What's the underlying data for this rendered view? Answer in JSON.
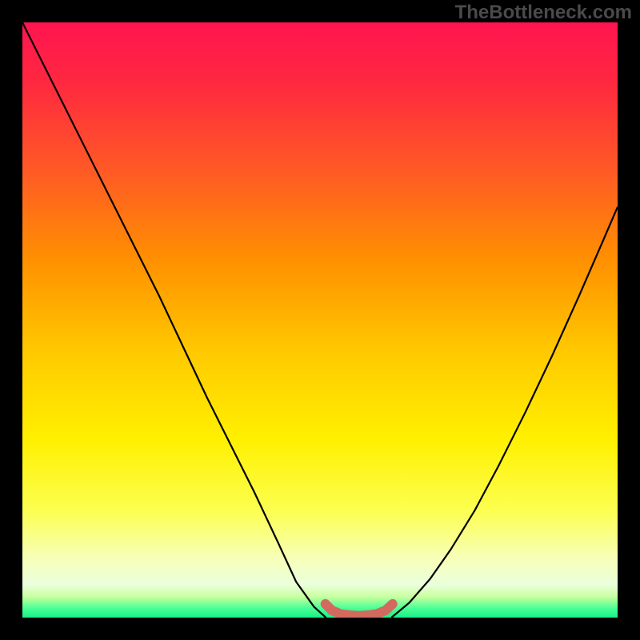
{
  "watermark": "TheBottleneck.com",
  "frame": {
    "outer_width": 800,
    "outer_height": 800,
    "border_px": 28,
    "border_color": "#000000"
  },
  "gradient": {
    "stops": [
      {
        "offset": 0.0,
        "color": "#ff1450"
      },
      {
        "offset": 0.1,
        "color": "#ff2840"
      },
      {
        "offset": 0.25,
        "color": "#ff5a25"
      },
      {
        "offset": 0.4,
        "color": "#ff9000"
      },
      {
        "offset": 0.55,
        "color": "#ffc800"
      },
      {
        "offset": 0.7,
        "color": "#fff000"
      },
      {
        "offset": 0.82,
        "color": "#fcff50"
      },
      {
        "offset": 0.9,
        "color": "#f7ffb8"
      },
      {
        "offset": 0.945,
        "color": "#eaffdc"
      },
      {
        "offset": 0.965,
        "color": "#c8ff9e"
      },
      {
        "offset": 0.985,
        "color": "#46ff96"
      },
      {
        "offset": 1.0,
        "color": "#18f086"
      }
    ]
  },
  "chart_data": {
    "type": "line",
    "title": "",
    "xlabel": "",
    "ylabel": "",
    "xlim": [
      0,
      1
    ],
    "ylim": [
      0,
      1
    ],
    "series": [
      {
        "name": "curve-left",
        "stroke": "#000000",
        "width": 2.2,
        "x": [
          0.0,
          0.03,
          0.07,
          0.11,
          0.15,
          0.19,
          0.23,
          0.27,
          0.31,
          0.35,
          0.39,
          0.43,
          0.46,
          0.49,
          0.51
        ],
        "y": [
          1.0,
          0.94,
          0.86,
          0.78,
          0.7,
          0.62,
          0.54,
          0.455,
          0.37,
          0.29,
          0.21,
          0.125,
          0.06,
          0.018,
          0.0
        ]
      },
      {
        "name": "curve-right",
        "stroke": "#000000",
        "width": 2.2,
        "x": [
          0.62,
          0.65,
          0.685,
          0.72,
          0.76,
          0.8,
          0.845,
          0.89,
          0.935,
          0.975,
          1.0
        ],
        "y": [
          0.0,
          0.025,
          0.065,
          0.115,
          0.18,
          0.255,
          0.345,
          0.44,
          0.54,
          0.632,
          0.69
        ]
      },
      {
        "name": "flat-bottom",
        "stroke": "#d26a60",
        "width": 12,
        "linecap": "round",
        "x": [
          0.509,
          0.52,
          0.535,
          0.55,
          0.565,
          0.58,
          0.595,
          0.61,
          0.622
        ],
        "y": [
          0.023,
          0.012,
          0.006,
          0.004,
          0.003,
          0.004,
          0.006,
          0.012,
          0.023
        ]
      }
    ]
  }
}
